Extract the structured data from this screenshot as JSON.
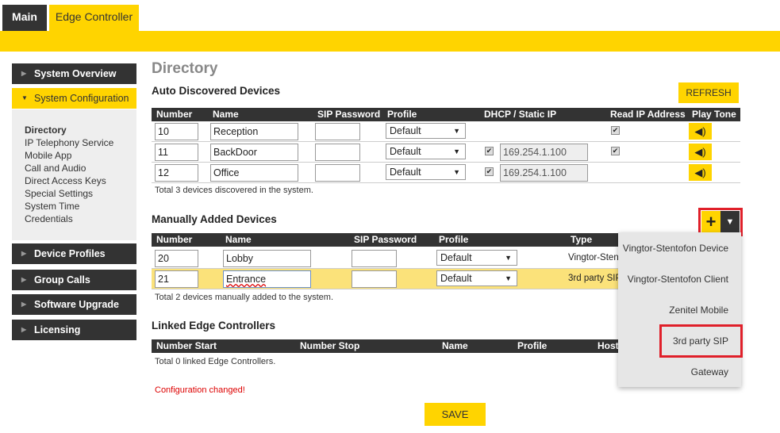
{
  "tabs": {
    "main": "Main",
    "edge_controller": "Edge Controller"
  },
  "sidebar": {
    "system_overview": "System Overview",
    "system_configuration": "System Configuration",
    "submenu": [
      "Directory",
      "IP Telephony Service",
      "Mobile App",
      "Call and Audio",
      "Direct Access Keys",
      "Special Settings",
      "System Time",
      "Credentials"
    ],
    "device_profiles": "Device Profiles",
    "group_calls": "Group Calls",
    "software_upgrade": "Software Upgrade",
    "licensing": "Licensing"
  },
  "page_title": "Directory",
  "auto": {
    "title": "Auto Discovered Devices",
    "refresh": "REFRESH",
    "headers": [
      "Number",
      "Name",
      "SIP Password",
      "Profile",
      "DHCP / Static IP",
      "Read IP Address",
      "Play Tone"
    ],
    "rows": [
      {
        "number": "10",
        "name": "Reception",
        "profile": "Default",
        "static": false,
        "ip": "",
        "read_ip": true
      },
      {
        "number": "11",
        "name": "BackDoor",
        "profile": "Default",
        "static": true,
        "ip": "169.254.1.100",
        "read_ip": true
      },
      {
        "number": "12",
        "name": "Office",
        "profile": "Default",
        "static": true,
        "ip": "169.254.1.100",
        "read_ip": false
      }
    ],
    "total": "Total 3 devices discovered in the system."
  },
  "manual": {
    "title": "Manually Added Devices",
    "headers": [
      "Number",
      "Name",
      "SIP Password",
      "Profile",
      "Type"
    ],
    "rows": [
      {
        "number": "20",
        "name": "Lobby",
        "profile": "Default",
        "type": "Vingtor-Stentofon Device"
      },
      {
        "number": "21",
        "name": "Entrance",
        "profile": "Default",
        "type": "3rd party SIP"
      }
    ],
    "total": "Total 2 devices manually added to the system.",
    "add_icon": "+",
    "dropdown_icon": "▼",
    "menu": [
      "Vingtor-Stentofon Device",
      "Vingtor-Stentofon Client",
      "Zenitel Mobile",
      "3rd party SIP",
      "Gateway"
    ]
  },
  "linked": {
    "title": "Linked Edge Controllers",
    "headers": [
      "Number Start",
      "Number Stop",
      "Name",
      "Profile",
      "Host"
    ],
    "total": "Total 0 linked Edge Controllers."
  },
  "status": "Configuration changed!",
  "save": "SAVE",
  "colors": {
    "accent": "#ffd400",
    "dark": "#333333",
    "error": "#e0202a"
  }
}
